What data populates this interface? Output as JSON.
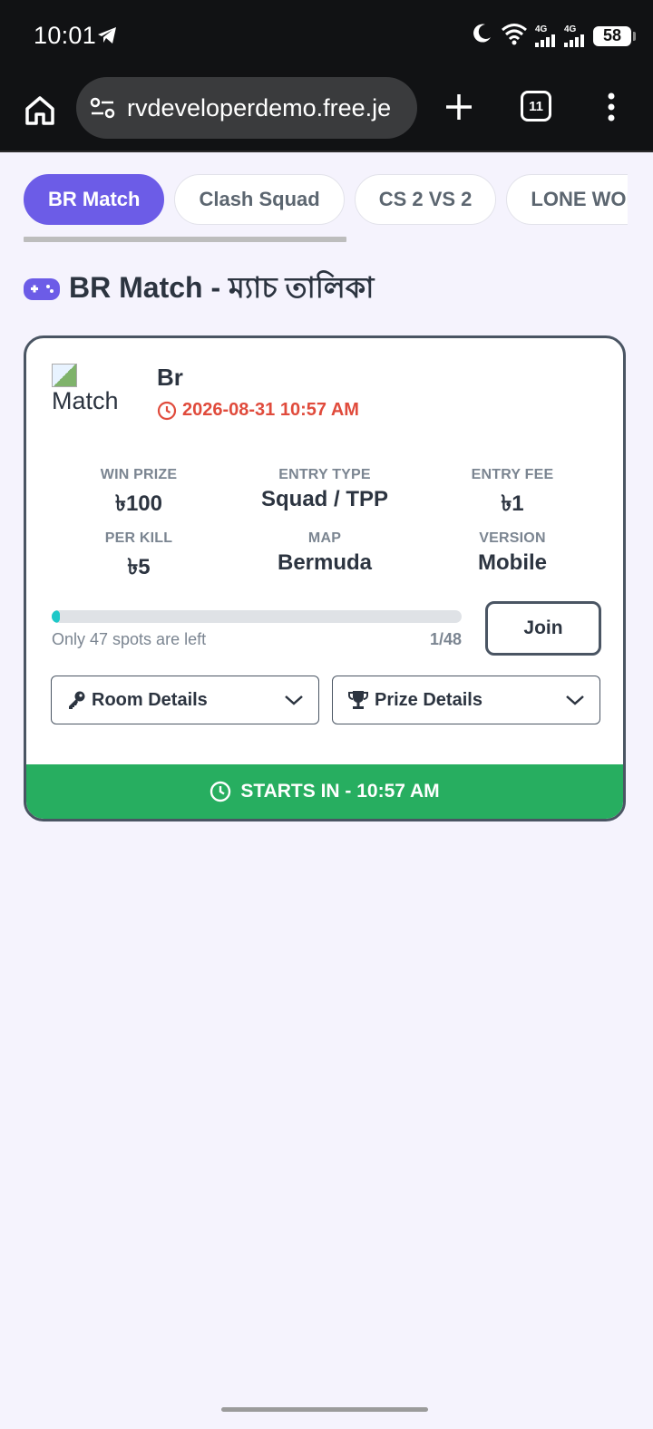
{
  "status_bar": {
    "time": "10:01",
    "battery": "58",
    "net1": "4G",
    "net2": "4G"
  },
  "browser": {
    "url": "rvdeveloperdemo.free.je",
    "tab_count": "11"
  },
  "tabs": [
    {
      "label": "BR Match",
      "active": true
    },
    {
      "label": "Clash Squad",
      "active": false
    },
    {
      "label": "CS 2 VS 2",
      "active": false
    },
    {
      "label": "LONE WOLF",
      "active": false
    }
  ],
  "section": {
    "title": "BR Match - ম্যাচ তালিকা"
  },
  "match": {
    "image_alt": "Match",
    "title": "Br",
    "datetime": "2026-08-31 10:57 AM",
    "stats": {
      "win_prize": {
        "label": "WIN PRIZE",
        "value": "৳100"
      },
      "entry_type": {
        "label": "ENTRY TYPE",
        "value": "Squad / TPP"
      },
      "entry_fee": {
        "label": "ENTRY FEE",
        "value": "৳1"
      },
      "per_kill": {
        "label": "PER KILL",
        "value": "৳5"
      },
      "map": {
        "label": "MAP",
        "value": "Bermuda"
      },
      "version": {
        "label": "VERSION",
        "value": "Mobile"
      }
    },
    "spots_left_text": "Only 47 spots are left",
    "spots_count": "1/48",
    "progress_fraction": 0.0208,
    "join_label": "Join",
    "room_details_label": "Room Details",
    "prize_details_label": "Prize Details",
    "starts_in": "STARTS IN - 10:57 AM"
  },
  "colors": {
    "accent": "#6c5ce7",
    "danger": "#e04b3c",
    "success": "#27ae60",
    "progress": "#1ec8c8"
  }
}
